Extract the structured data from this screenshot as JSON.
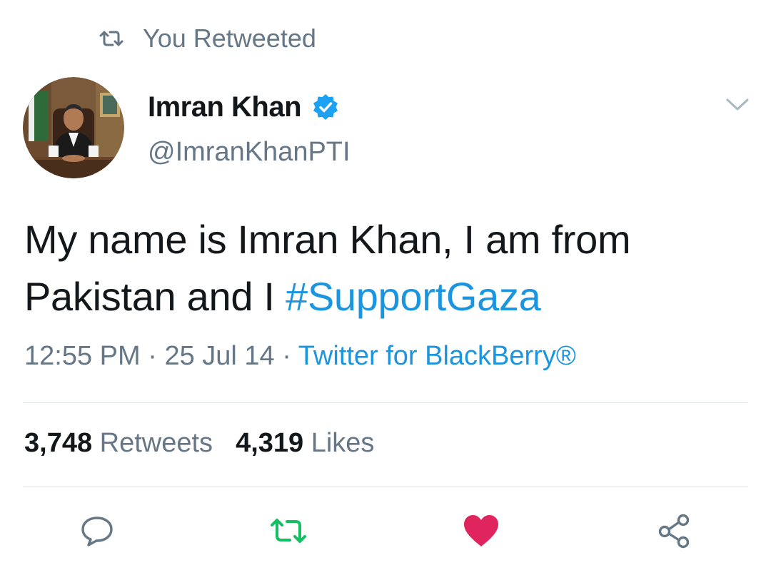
{
  "retweet_context": {
    "label": "You Retweeted",
    "icon": "retweet-icon"
  },
  "author": {
    "name": "Imran Khan",
    "verified": true,
    "handle": "@ImranKhanPTI",
    "avatar_icon": "profile-photo"
  },
  "tweet": {
    "text_plain": "My name is Imran Khan, I am from Pakistan and I ",
    "hashtag": "#SupportGaza"
  },
  "meta": {
    "time": "12:55 PM",
    "separator1": " · ",
    "date": "25 Jul 14",
    "separator2": " · ",
    "source": "Twitter for BlackBerry®"
  },
  "stats": {
    "retweets_count": "3,748",
    "retweets_label": " Retweets",
    "likes_count": "4,319",
    "likes_label": " Likes"
  },
  "actions": {
    "reply_icon": "reply-icon",
    "retweet_icon": "retweet-icon",
    "like_icon": "heart-icon",
    "share_icon": "share-icon"
  },
  "colors": {
    "link": "#1b95e0",
    "muted": "#657786",
    "text": "#14171a",
    "retweeted_green": "#17bf63",
    "liked_red": "#e0245e",
    "divider": "#e1e8ed"
  }
}
